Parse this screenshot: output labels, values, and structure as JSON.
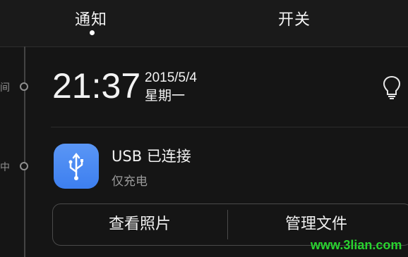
{
  "tabs": {
    "notifications": "通知",
    "switches": "开关"
  },
  "timeline": {
    "label_time": "间",
    "label_ongoing": "中"
  },
  "clock": {
    "time": "21:37",
    "date": "2015/5/4",
    "weekday": "星期一"
  },
  "icons": {
    "bulb": "lightbulb-icon",
    "usb": "usb-icon"
  },
  "notification": {
    "title": "USB 已连接",
    "subtitle": "仅充电",
    "icon_color": "#4a8cf4"
  },
  "actions": {
    "view_photos": "查看照片",
    "manage_files": "管理文件"
  },
  "watermark": {
    "text": "www.3lian.com"
  }
}
